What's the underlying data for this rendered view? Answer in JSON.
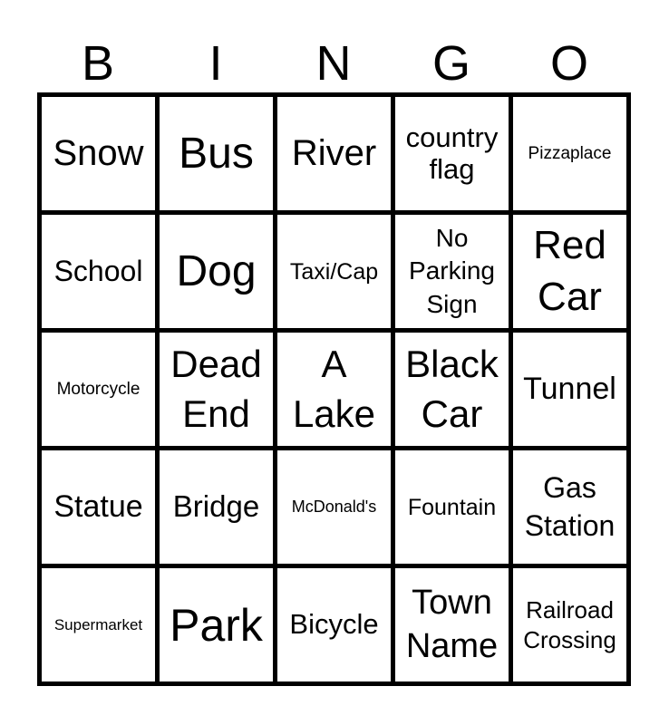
{
  "header": [
    "B",
    "I",
    "N",
    "G",
    "O"
  ],
  "cells": [
    "Snow",
    "Bus",
    "River",
    "country flag",
    "Pizzaplace",
    "School",
    "Dog",
    "Taxi/Cap",
    "No Parking Sign",
    "Red Car",
    "Motorcycle",
    "Dead End",
    "A Lake",
    "Black Car",
    "Tunnel",
    "Statue",
    "Bridge",
    "McDonald's",
    "Fountain",
    "Gas Station",
    "Supermarket",
    "Park",
    "Bicycle",
    "Town Name",
    "Railroad Crossing"
  ]
}
